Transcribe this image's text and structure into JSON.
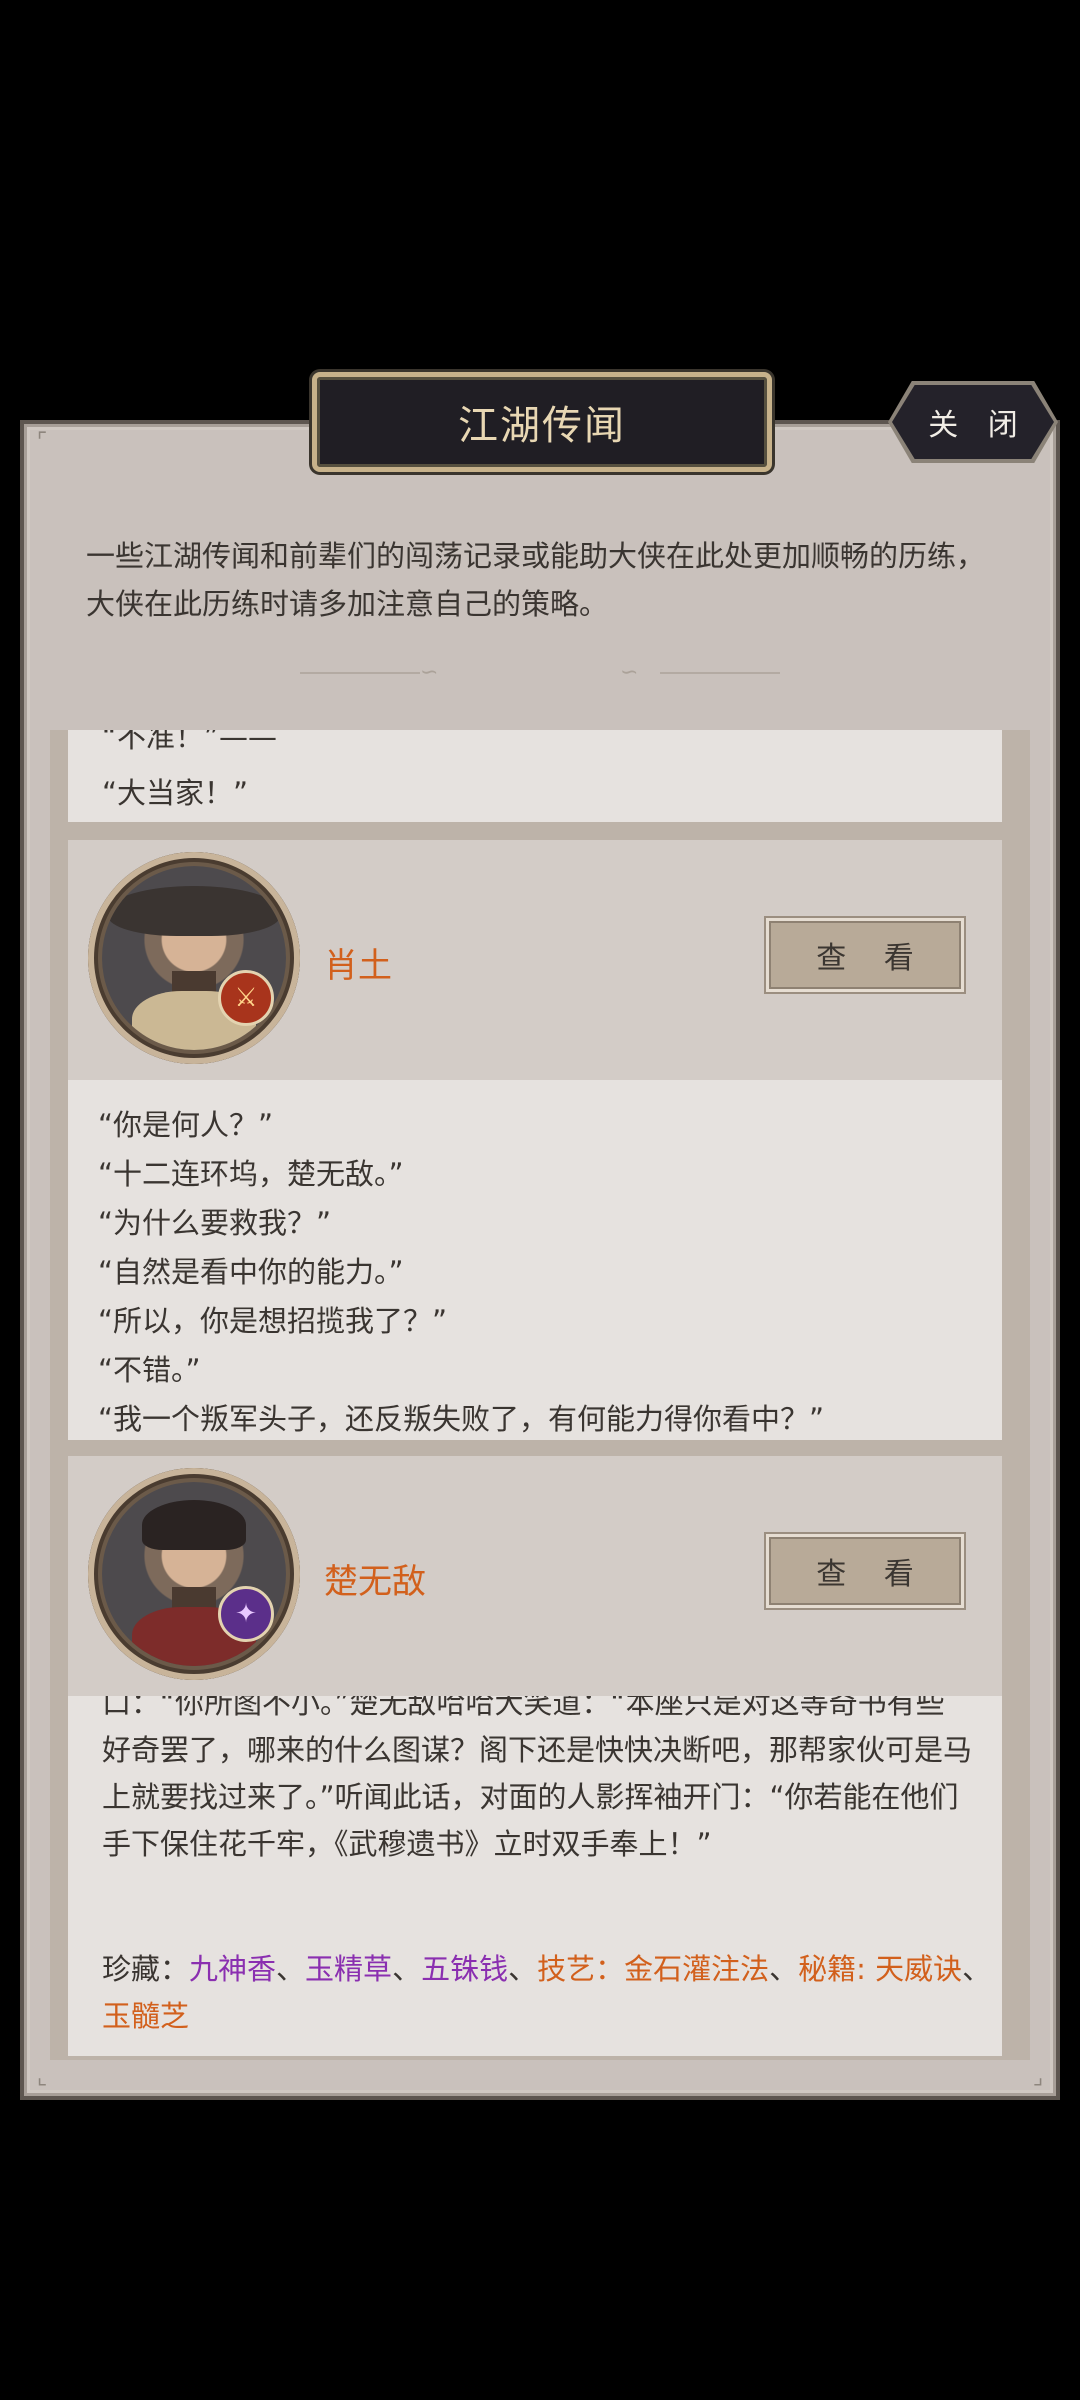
{
  "header": {
    "title": "江湖传闻",
    "close_label": "关 闭"
  },
  "description": "一些江湖传闻和前辈们的闯荡记录或能助大侠在此处更加顺畅的历练，大侠在此历练时请多加注意自己的策略。",
  "top_card": {
    "lines": [
      "“不准！”——",
      "“大当家！”"
    ]
  },
  "cards": [
    {
      "name": "肖土",
      "view_label": "查 看",
      "badge_icon": "flame-sword-icon",
      "dialogue": [
        "“你是何人？”",
        "“十二连环坞，楚无敌。”",
        "“为什么要救我？”",
        "“自然是看中你的能力。”",
        "“所以，你是想招揽我了？”",
        "“不错。”",
        "“我一个叛军头子，还反叛失败了，有何能力得你看中？”"
      ]
    },
    {
      "name": "楚无敌",
      "view_label": "查 看",
      "badge_icon": "arcane-flame-icon",
      "story": "口：“你所图不小。”楚无敌哈哈大笑道：“本座只是对这等奇书有些好奇罢了，哪来的什么图谋？阁下还是快快决断吧，那帮家伙可是马上就要找过来了。”听闻此话，对面的人影挥袖开门：“你若能在他们手下保住花千牢，《武穆遗书》立时双手奉上！”",
      "loot": {
        "label": "珍藏：",
        "items_purple": [
          "九神香",
          "玉精草",
          "五铢钱"
        ],
        "skill_label": "技艺：",
        "skill": "金石灌注法",
        "book_label": "秘籍: ",
        "book": "天威诀",
        "extra": "玉髓芝",
        "sep": "、"
      }
    }
  ],
  "colors": {
    "panel_bg": "#c9c1bc",
    "card_bg": "#e6e2df",
    "name_orange": "#d2601c",
    "loot_purple": "#8a2fb0",
    "title_gold": "#e8d7b3"
  }
}
